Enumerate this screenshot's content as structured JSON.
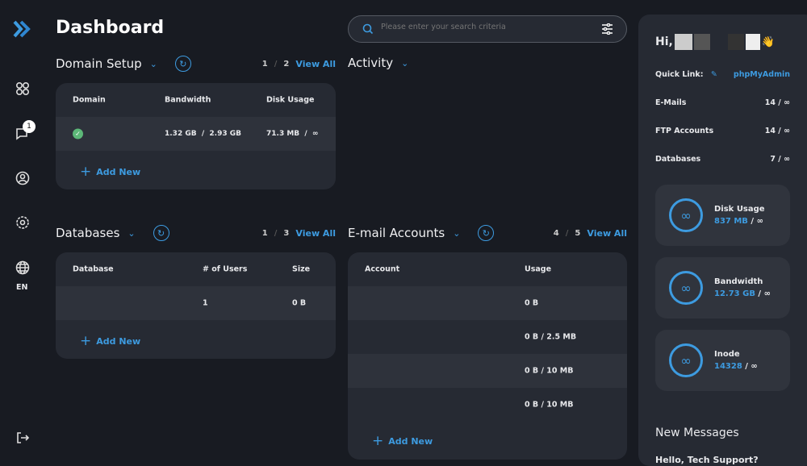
{
  "app": {
    "title": "Dashboard",
    "accent": "#3d9be0",
    "language": "EN"
  },
  "sidebar": {
    "notification_count": "1"
  },
  "search": {
    "placeholder": "Please enter your search criteria"
  },
  "domain_setup": {
    "title": "Domain Setup",
    "page": "1",
    "pages": "2",
    "view_all": "View All",
    "columns": [
      "Domain",
      "Bandwidth",
      "Disk Usage"
    ],
    "rows": [
      {
        "status": "active",
        "bandwidth": "1.32 GB  /  2.93 GB",
        "disk": "71.3 MB  /  ∞"
      }
    ],
    "add_new": "Add New"
  },
  "activity": {
    "title": "Activity"
  },
  "databases": {
    "title": "Databases",
    "page": "1",
    "pages": "3",
    "view_all": "View All",
    "columns": [
      "Database",
      "# of Users",
      "Size"
    ],
    "rows": [
      {
        "users": "1",
        "size": "0 B"
      }
    ],
    "add_new": "Add New"
  },
  "email": {
    "title": "E-mail Accounts",
    "page": "4",
    "pages": "5",
    "view_all": "View All",
    "columns": [
      "Account",
      "Usage"
    ],
    "rows": [
      "0 B",
      "0 B / 2.5 MB",
      "0 B / 10 MB",
      "0 B / 10 MB"
    ],
    "add_new": "Add New"
  },
  "panel": {
    "greeting": "Hi,",
    "wave": "👋",
    "quick_link_label": "Quick Link:",
    "quick_link": "phpMyAdmin",
    "stats": [
      {
        "label": "E-Mails",
        "value": "14 / ∞"
      },
      {
        "label": "FTP Accounts",
        "value": "14 / ∞"
      },
      {
        "label": "Databases",
        "value": "7 / ∞"
      }
    ],
    "usage": [
      {
        "label": "Disk Usage",
        "used": "837 MB",
        "limit": "∞"
      },
      {
        "label": "Bandwidth",
        "used": "12.73 GB",
        "limit": "∞"
      },
      {
        "label": "Inode",
        "used": "14328",
        "limit": "∞"
      }
    ],
    "messages_title": "New Messages",
    "message_preview": "Hello, Tech Support?"
  }
}
